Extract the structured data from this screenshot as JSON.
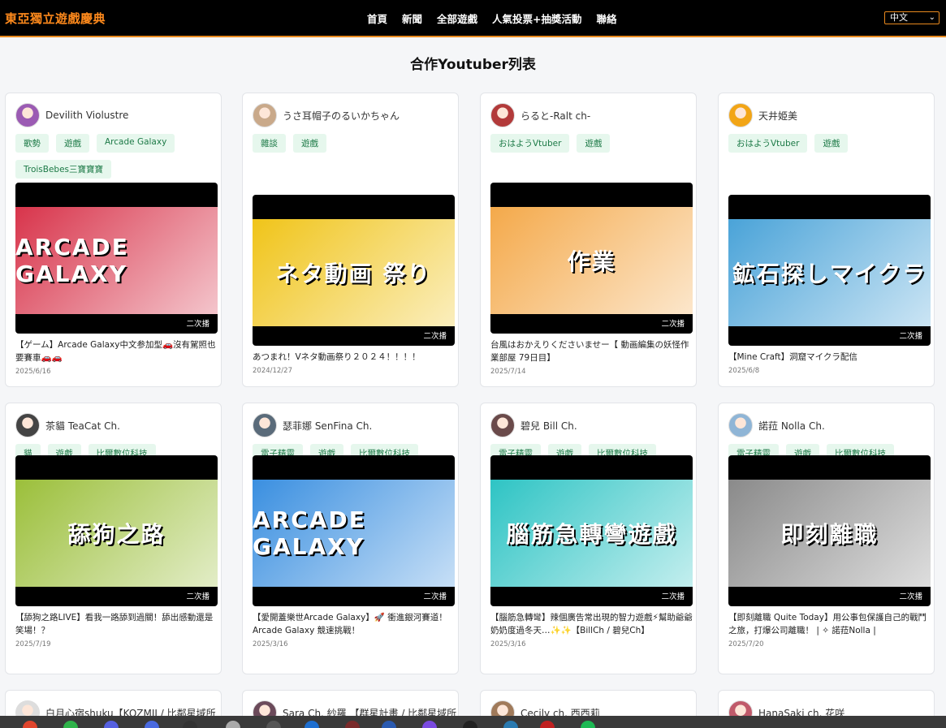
{
  "header": {
    "brand": "東亞獨立遊戲慶典",
    "nav": [
      {
        "label": "首頁"
      },
      {
        "label": "新聞"
      },
      {
        "label": "全部遊戲"
      },
      {
        "label": "人氣投票+抽獎活動"
      },
      {
        "label": "聯絡"
      }
    ],
    "language": "中文"
  },
  "page_title": "合作Youtuber列表",
  "badge_label": "二次播",
  "cards": [
    {
      "name": "Devilith Violustre",
      "tags": [
        "歌勢",
        "遊戲",
        "Arcade Galaxy",
        "TroisBebes三寶寶寶"
      ],
      "thumb_text": "ARCADE GALAXY",
      "thumb_color": "#d8344b",
      "avatar_color": "#9b5bb3",
      "title": "【ゲーム】Arcade Galaxy中文参加型🚗沒有駕照也要賽車🚗🚗",
      "date": "2025/6/16"
    },
    {
      "name": "うさ耳帽子のるいかちゃん",
      "tags": [
        "雜談",
        "遊戲"
      ],
      "thumb_text": "ネタ動画 祭り",
      "thumb_color": "#f0c419",
      "avatar_color": "#c9a98a",
      "title": "あつまれ！Vネタ動画祭り２０２４！！！！",
      "date": "2024/12/27"
    },
    {
      "name": "らると-Ralt ch-",
      "tags": [
        "おはようVtuber",
        "遊戲"
      ],
      "thumb_text": "作業",
      "thumb_color": "#f4a94a",
      "avatar_color": "#b23a3a",
      "title": "台風はおかえりくださいませー【 動画編集の妖怪作業部屋 79日目】",
      "date": "2025/7/14"
    },
    {
      "name": "天井姫美",
      "tags": [
        "おはようVtuber",
        "遊戲"
      ],
      "thumb_text": "鉱石探しマイクラ",
      "thumb_color": "#4aa3d8",
      "avatar_color": "#f2a516",
      "title": "【Mine Craft】洞窟マイクラ配信",
      "date": "2025/6/8"
    },
    {
      "name": "茶貓 TeaCat Ch.",
      "tags": [
        "貓",
        "遊戲",
        "比爾數位科技"
      ],
      "thumb_text": "舔狗之路",
      "thumb_color": "#9bbf3a",
      "avatar_color": "#444444",
      "title": "【舔狗之路LIVE】看我一路舔到過關！舔出感動還是笑場！？",
      "date": "2025/7/19"
    },
    {
      "name": "瑟菲娜 SenFina Ch.",
      "tags": [
        "電子精靈",
        "遊戲",
        "比爾數位科技"
      ],
      "thumb_text": "ARCADE GALAXY",
      "thumb_color": "#3a8fe0",
      "avatar_color": "#5a6b7a",
      "title": "【愛開蓋樂世Arcade Galaxy】🚀 衝進銀河賽道！Arcade Galaxy 競速挑戰！",
      "date": "2025/3/16"
    },
    {
      "name": "碧兒 Bill Ch.",
      "tags": [
        "電子精靈",
        "遊戲",
        "比爾數位科技"
      ],
      "thumb_text": "腦筋急轉彎遊戲",
      "thumb_color": "#2ec4c4",
      "avatar_color": "#6a4a4a",
      "title": "【腦筋急轉彎】辣個廣告常出現的智力遊戲⚡幫助爺爺奶奶度過冬天…✨✨【BillCh / 碧兒Ch】",
      "date": "2025/3/16"
    },
    {
      "name": "諾菈 Nolla Ch.",
      "tags": [
        "電子精靈",
        "遊戲",
        "比爾數位科技"
      ],
      "thumb_text": "即刻離職",
      "thumb_color": "#8a8a8a",
      "avatar_color": "#8fb5d6",
      "title": "【即刻離職 Quite Today】用公事包保護自己的戰鬥之旅，打爆公司離職！ | ✧ 諾菈Nolla |",
      "date": "2025/7/20"
    },
    {
      "name": "白月心宿shuku【KOZMII / 比鄰星域所",
      "tags": [],
      "thumb_text": "",
      "thumb_color": "#dddddd",
      "avatar_color": "#dddddd",
      "title": "",
      "date": ""
    },
    {
      "name": "Sara Ch. 紗羅 【群星計畫 / 比鄰星域所",
      "tags": [],
      "thumb_text": "",
      "thumb_color": "#dddddd",
      "avatar_color": "#6b4a5a",
      "title": "",
      "date": ""
    },
    {
      "name": "Cecily ch. 西西莉",
      "tags": [],
      "thumb_text": "",
      "thumb_color": "#dddddd",
      "avatar_color": "#a07a5a",
      "title": "",
      "date": ""
    },
    {
      "name": "HanaSaki ch. 花咲",
      "tags": [],
      "thumb_text": "",
      "thumb_color": "#dddddd",
      "avatar_color": "#c05a6a",
      "title": "",
      "date": ""
    }
  ],
  "taskbar_icons": [
    "#e0452c",
    "#2fb34a",
    "#5560e0",
    "#4a6ae0",
    "#333333",
    "#aaaaaa",
    "#555555",
    "#1e6fd0",
    "#7a2a2a",
    "#2a5ab0",
    "#7a4ae0",
    "#222222",
    "#2a7ab0",
    "#c02020",
    "#1db954",
    "#1db954",
    "#e04a3a"
  ]
}
